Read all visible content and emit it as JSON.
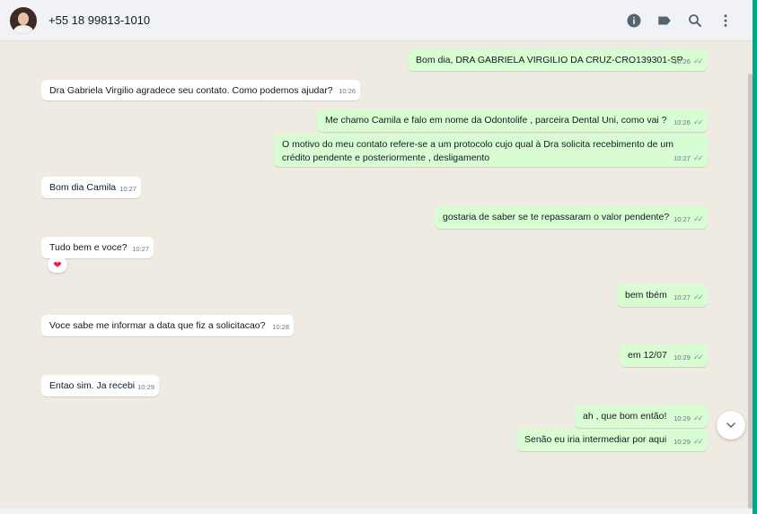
{
  "header": {
    "contact": "+55 18 99813-1010",
    "icons": [
      "info-icon",
      "label-icon",
      "search-icon",
      "menu-icon"
    ]
  },
  "messages": [
    {
      "dir": "out",
      "text": "Bom dia, DRA GABRIELA VIRGILIO DA CRUZ-CRO139301-SP",
      "time": "10:26"
    },
    {
      "dir": "in",
      "text": "Dra Gabriela Virgilio agradece seu contato. Como podemos ajudar?",
      "time": "10:26"
    },
    {
      "dir": "out",
      "text": "Me chamo Camila e falo em nome da Odontolife , parceira Dental Uni, como vai ?",
      "time": "10:26"
    },
    {
      "dir": "out",
      "text": "O motivo do meu contato refere-se a um protocolo cujo qual à Dra solicita recebimento de um crédito pendente e posteriormente , desligamento",
      "time": "10:27"
    },
    {
      "dir": "in",
      "text": "Bom dia Camila",
      "time": "10:27"
    },
    {
      "dir": "out",
      "text": "gostaria de saber se te repassaram o valor pendente?",
      "time": "10:27"
    },
    {
      "dir": "in",
      "text": "Tudo bem e voce?",
      "time": "10:27",
      "reaction": "❤"
    },
    {
      "dir": "out",
      "text": "bem tbém",
      "time": "10:27"
    },
    {
      "dir": "in",
      "text": "Voce sabe me informar a data  que fiz a solicitacao?",
      "time": "10:28"
    },
    {
      "dir": "out",
      "text": "em 12/07",
      "time": "10:29"
    },
    {
      "dir": "in",
      "text": "Entao sim. Ja recebi",
      "time": "10:29"
    },
    {
      "dir": "out",
      "text": "ah , que bom então!",
      "time": "10:29"
    },
    {
      "dir": "out",
      "text": "Senão eu iria intermediar por aqui",
      "time": "10:29"
    }
  ],
  "ticks": "✓✓"
}
